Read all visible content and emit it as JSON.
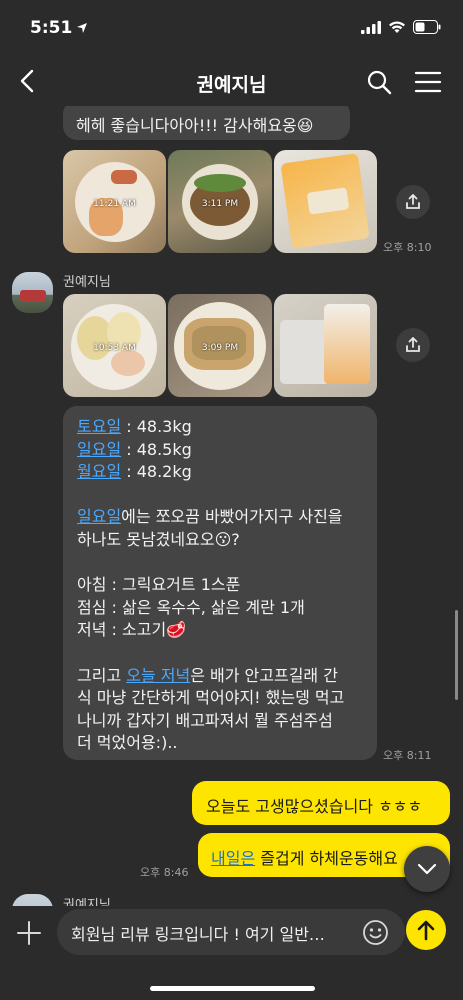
{
  "status": {
    "time": "5:51"
  },
  "nav": {
    "title": "권예지님"
  },
  "messages": {
    "top_bubble": "헤헤 좋습니다아아!!! 감사해요옹",
    "top_bubble_emoji": "😆",
    "group1": {
      "photo_times": [
        "11:21 AM",
        "3:11 PM",
        ""
      ],
      "time": "오후 8:10"
    },
    "sender_name": "권예지님",
    "group2": {
      "photo_times": [
        "10:53 AM",
        "3:09 PM",
        ""
      ]
    },
    "weights": [
      {
        "day": "토요일",
        "value": " : 48.3kg"
      },
      {
        "day": "일요일",
        "value": " : 48.5kg"
      },
      {
        "day": "월요일",
        "value": " : 48.2kg"
      }
    ],
    "sunday_link": "일요일",
    "sunday_rest_1": "에는 쪼오끔 바빴어가지구 사진을",
    "sunday_rest_2": "하나도 못남겼네요오",
    "sunday_emoji": "😗?",
    "meals": [
      "아침 : 그릭요거트 1스푼",
      "점심 : 삶은 옥수수, 삶은 계란 1개",
      "저녁 : 소고기"
    ],
    "meat_emoji": "🥩",
    "evening_prefix": "그리고 ",
    "evening_link": "오늘 저녁",
    "evening_line1_rest": "은 배가 안고프길래 간",
    "evening_lines": [
      "식 마냥 간단하게 먹어야지! 했는뎅 먹고",
      "나니까 갑자기 배고파져서 뭘 주섬주섬",
      "더 먹었어용:).."
    ],
    "long_time": "오후 8:11",
    "me_bubble_1": "오늘도 고생많으셨습니다 ㅎㅎㅎ",
    "me_bubble_2_link": "내일은",
    "me_bubble_2_rest": " 즐겁게 하체운동해요",
    "me_time": "오후 8:46",
    "next_sender": "권예지님"
  },
  "input": {
    "value": "회원님 리뷰 링크입니다 ! 여기 일반…"
  },
  "colors": {
    "my_bubble": "#fee500",
    "other_bubble": "#444444",
    "link": "#4aa8ff",
    "background": "#2b2b2b"
  }
}
